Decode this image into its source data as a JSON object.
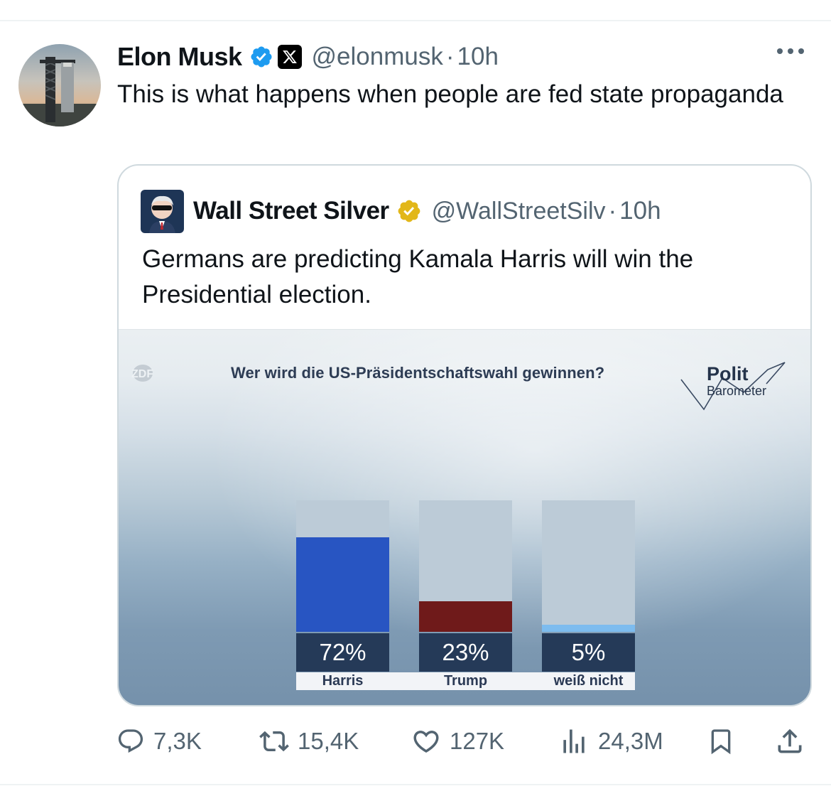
{
  "tweet": {
    "author_name": "Elon Musk",
    "handle": "@elonmusk",
    "separator": "·",
    "time": "10h",
    "text": "This is what happens when people are fed state propaganda"
  },
  "quoted_tweet": {
    "author_name": "Wall Street Silver",
    "handle": "@WallStreetSilv",
    "separator": "·",
    "time": "10h",
    "text": "Germans are predicting Kamala Harris will win the Presidential election."
  },
  "media": {
    "broadcaster_logo": "ZDF",
    "question": "Wer wird die US-Präsidentschaftswahl gewinnen?",
    "brand_title": "Polit",
    "brand_subtitle": "Barometer"
  },
  "chart_data": {
    "type": "bar",
    "title": "Wer wird die US-Präsidentschaftswahl gewinnen?",
    "categories": [
      "Harris",
      "Trump",
      "weiß nicht"
    ],
    "values": [
      72,
      23,
      5
    ],
    "value_labels": [
      "72%",
      "23%",
      "5%"
    ],
    "ylim": [
      0,
      100
    ],
    "colors": [
      "#2855c2",
      "#6f1a1a",
      "#7dbcef"
    ],
    "track_color": "#bccbd7"
  },
  "actions": {
    "replies": "7,3K",
    "retweets": "15,4K",
    "likes": "127K",
    "views": "24,3M"
  },
  "colors": {
    "text": "#0f1419",
    "secondary": "#536471",
    "verified_blue": "#1d9bf0",
    "verified_gold": "#e2b719",
    "border": "#cfd9de"
  },
  "icons": {
    "verified": "verified-check-icon",
    "x_logo": "x-logo-icon",
    "gold_verified": "gold-verified-icon",
    "more": "more-dots-icon",
    "reply": "reply-bubble-icon",
    "retweet": "retweet-icon",
    "like": "heart-icon",
    "views": "bar-chart-icon",
    "bookmark": "bookmark-icon",
    "share": "share-icon"
  }
}
